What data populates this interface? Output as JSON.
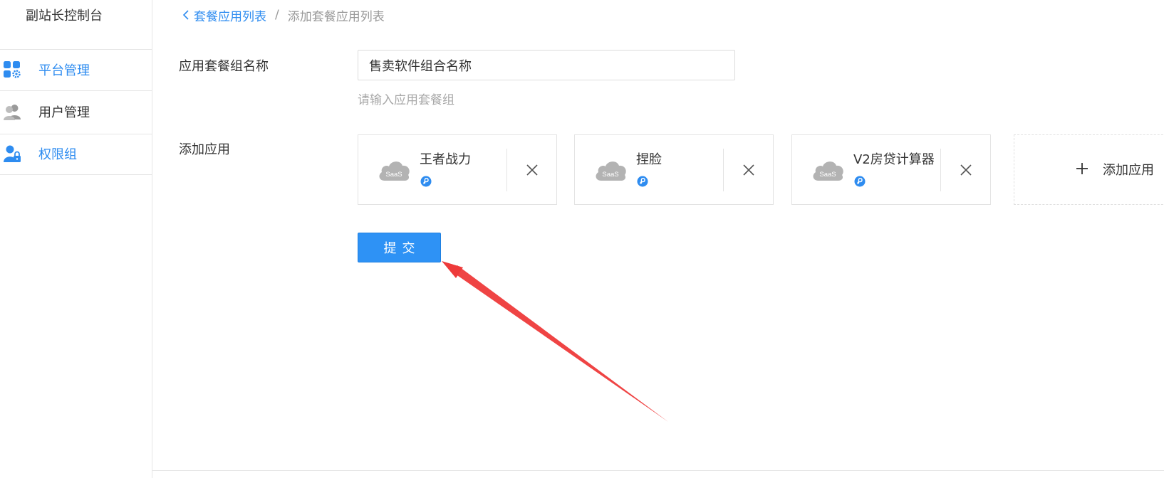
{
  "sidebar": {
    "title": "副站长控制台",
    "items": [
      {
        "label": "平台管理",
        "icon": "apps-gear-icon",
        "active": true
      },
      {
        "label": "用户管理",
        "icon": "users-icon",
        "active": false
      },
      {
        "label": "权限组",
        "icon": "user-lock-icon",
        "active": false
      }
    ]
  },
  "breadcrumb": {
    "back_label": "套餐应用列表",
    "separator": "/",
    "current": "添加套餐应用列表"
  },
  "form": {
    "group_name_label": "应用套餐组名称",
    "group_name_value": "售卖软件组合名称",
    "group_name_hint": "请输入应用套餐组",
    "add_apps_label": "添加应用",
    "apps": [
      {
        "name": "王者战力",
        "icon_text": "SaaS"
      },
      {
        "name": "捏脸",
        "icon_text": "SaaS"
      },
      {
        "name": "V2房贷计算器",
        "icon_text": "SaaS"
      }
    ],
    "add_app_button": "添加应用",
    "submit_label": "提交"
  },
  "colors": {
    "accent": "#2e8cf0",
    "button": "#2e92f5",
    "arrow": "#ee3a3a",
    "icon_gray": "#b3b3b3"
  }
}
